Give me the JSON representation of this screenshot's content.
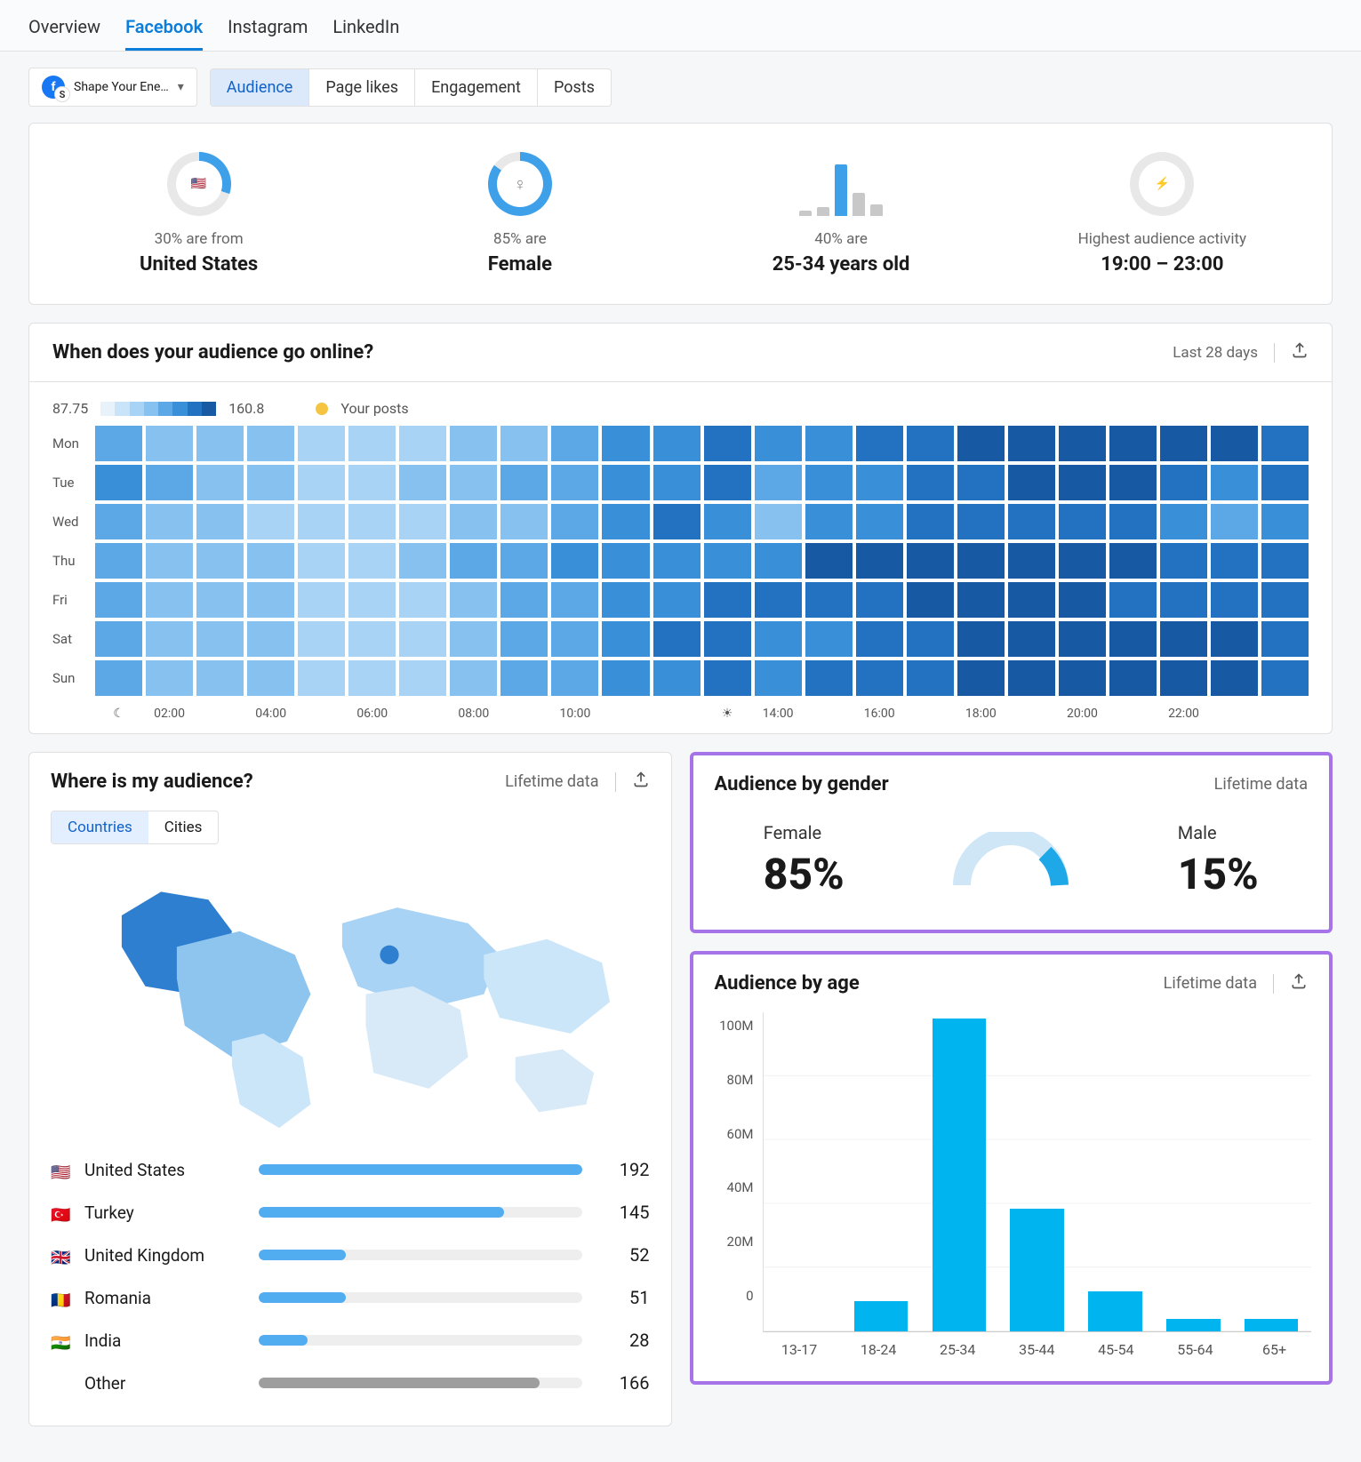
{
  "nav": {
    "tabs": [
      "Overview",
      "Facebook",
      "Instagram",
      "LinkedIn"
    ],
    "active": "Facebook"
  },
  "selector": {
    "page_name": "Shape Your Ene…"
  },
  "sub_tabs": {
    "items": [
      "Audience",
      "Page likes",
      "Engagement",
      "Posts"
    ],
    "active": "Audience"
  },
  "summary": {
    "country": {
      "sub": "30% are from",
      "main": "United States",
      "pct": 30,
      "flag": "🇺🇸"
    },
    "gender": {
      "sub": "85% are",
      "main": "Female",
      "pct": 85,
      "icon": "♀"
    },
    "age": {
      "sub": "40% are",
      "main": "25-34 years old",
      "bars": [
        8,
        14,
        80,
        36,
        18
      ]
    },
    "activity": {
      "sub": "Highest audience activity",
      "main": "19:00 – 23:00",
      "icon": "⚡"
    }
  },
  "heatmap": {
    "title": "When does your audience go online?",
    "range_label": "Last 28 days",
    "scale_min": "87.75",
    "scale_max": "160.8",
    "posts_label": "Your posts",
    "days": [
      "Mon",
      "Tue",
      "Wed",
      "Thu",
      "Fri",
      "Sat",
      "Sun"
    ],
    "x_ticks": [
      "",
      "02:00",
      "",
      "04:00",
      "",
      "06:00",
      "",
      "08:00",
      "",
      "10:00",
      "",
      "",
      "",
      "14:00",
      "",
      "16:00",
      "",
      "18:00",
      "",
      "20:00",
      "",
      "22:00",
      "",
      ""
    ],
    "night_icon": "☾",
    "day_icon": "☀",
    "data": [
      [
        4,
        3,
        3,
        3,
        2,
        2,
        2,
        3,
        3,
        4,
        5,
        5,
        6,
        5,
        5,
        6,
        6,
        7,
        7,
        7,
        7,
        7,
        7,
        6
      ],
      [
        5,
        4,
        3,
        3,
        2,
        2,
        3,
        3,
        4,
        4,
        5,
        5,
        6,
        4,
        5,
        5,
        6,
        6,
        7,
        7,
        7,
        6,
        5,
        6
      ],
      [
        4,
        3,
        3,
        2,
        2,
        2,
        2,
        3,
        3,
        4,
        5,
        6,
        5,
        3,
        5,
        5,
        6,
        6,
        6,
        6,
        6,
        5,
        4,
        5
      ],
      [
        4,
        3,
        3,
        3,
        2,
        2,
        3,
        4,
        4,
        5,
        5,
        5,
        5,
        5,
        7,
        7,
        7,
        7,
        7,
        7,
        7,
        6,
        6,
        6
      ],
      [
        4,
        3,
        3,
        3,
        2,
        2,
        2,
        3,
        4,
        4,
        5,
        5,
        6,
        6,
        6,
        6,
        7,
        7,
        7,
        7,
        6,
        6,
        6,
        6
      ],
      [
        4,
        3,
        3,
        3,
        2,
        2,
        2,
        3,
        4,
        4,
        5,
        6,
        6,
        5,
        5,
        6,
        6,
        7,
        7,
        7,
        7,
        7,
        7,
        6
      ],
      [
        4,
        3,
        3,
        3,
        2,
        2,
        2,
        3,
        4,
        4,
        5,
        5,
        6,
        5,
        6,
        6,
        6,
        7,
        7,
        7,
        7,
        7,
        7,
        6
      ]
    ]
  },
  "audience_loc": {
    "title": "Where is my audience?",
    "meta": "Lifetime data",
    "toggle": [
      "Countries",
      "Cities"
    ],
    "toggle_active": "Countries",
    "rows": [
      {
        "flag": "🇺🇸",
        "name": "United States",
        "value": 192,
        "pct": 100
      },
      {
        "flag": "🇹🇷",
        "name": "Turkey",
        "value": 145,
        "pct": 76
      },
      {
        "flag": "🇬🇧",
        "name": "United Kingdom",
        "value": 52,
        "pct": 27
      },
      {
        "flag": "🇷🇴",
        "name": "Romania",
        "value": 51,
        "pct": 27
      },
      {
        "flag": "🇮🇳",
        "name": "India",
        "value": 28,
        "pct": 15
      },
      {
        "flag": "",
        "name": "Other",
        "value": 166,
        "pct": 87,
        "gray": true
      }
    ]
  },
  "gender_card": {
    "title": "Audience by gender",
    "meta": "Lifetime data",
    "female_label": "Female",
    "female_val": "85%",
    "male_label": "Male",
    "male_val": "15%",
    "female_pct": 85
  },
  "age_card": {
    "title": "Audience by age",
    "meta": "Lifetime data"
  },
  "chart_data": {
    "type": "bar",
    "title": "Audience by age",
    "categories": [
      "13-17",
      "18-24",
      "25-34",
      "35-44",
      "45-54",
      "55-64",
      "65+"
    ],
    "values": [
      0,
      10,
      102,
      40,
      13,
      4,
      4
    ],
    "y_ticks": [
      "100M",
      "80M",
      "60M",
      "40M",
      "20M",
      "0"
    ],
    "ylim": [
      0,
      100
    ],
    "unit": "M"
  },
  "colors": {
    "heat": [
      "#e8f2fb",
      "#c9e3f8",
      "#a9d3f4",
      "#86c1ef",
      "#5ca8e6",
      "#3a8fd9",
      "#2372c2",
      "#175aa3"
    ]
  }
}
